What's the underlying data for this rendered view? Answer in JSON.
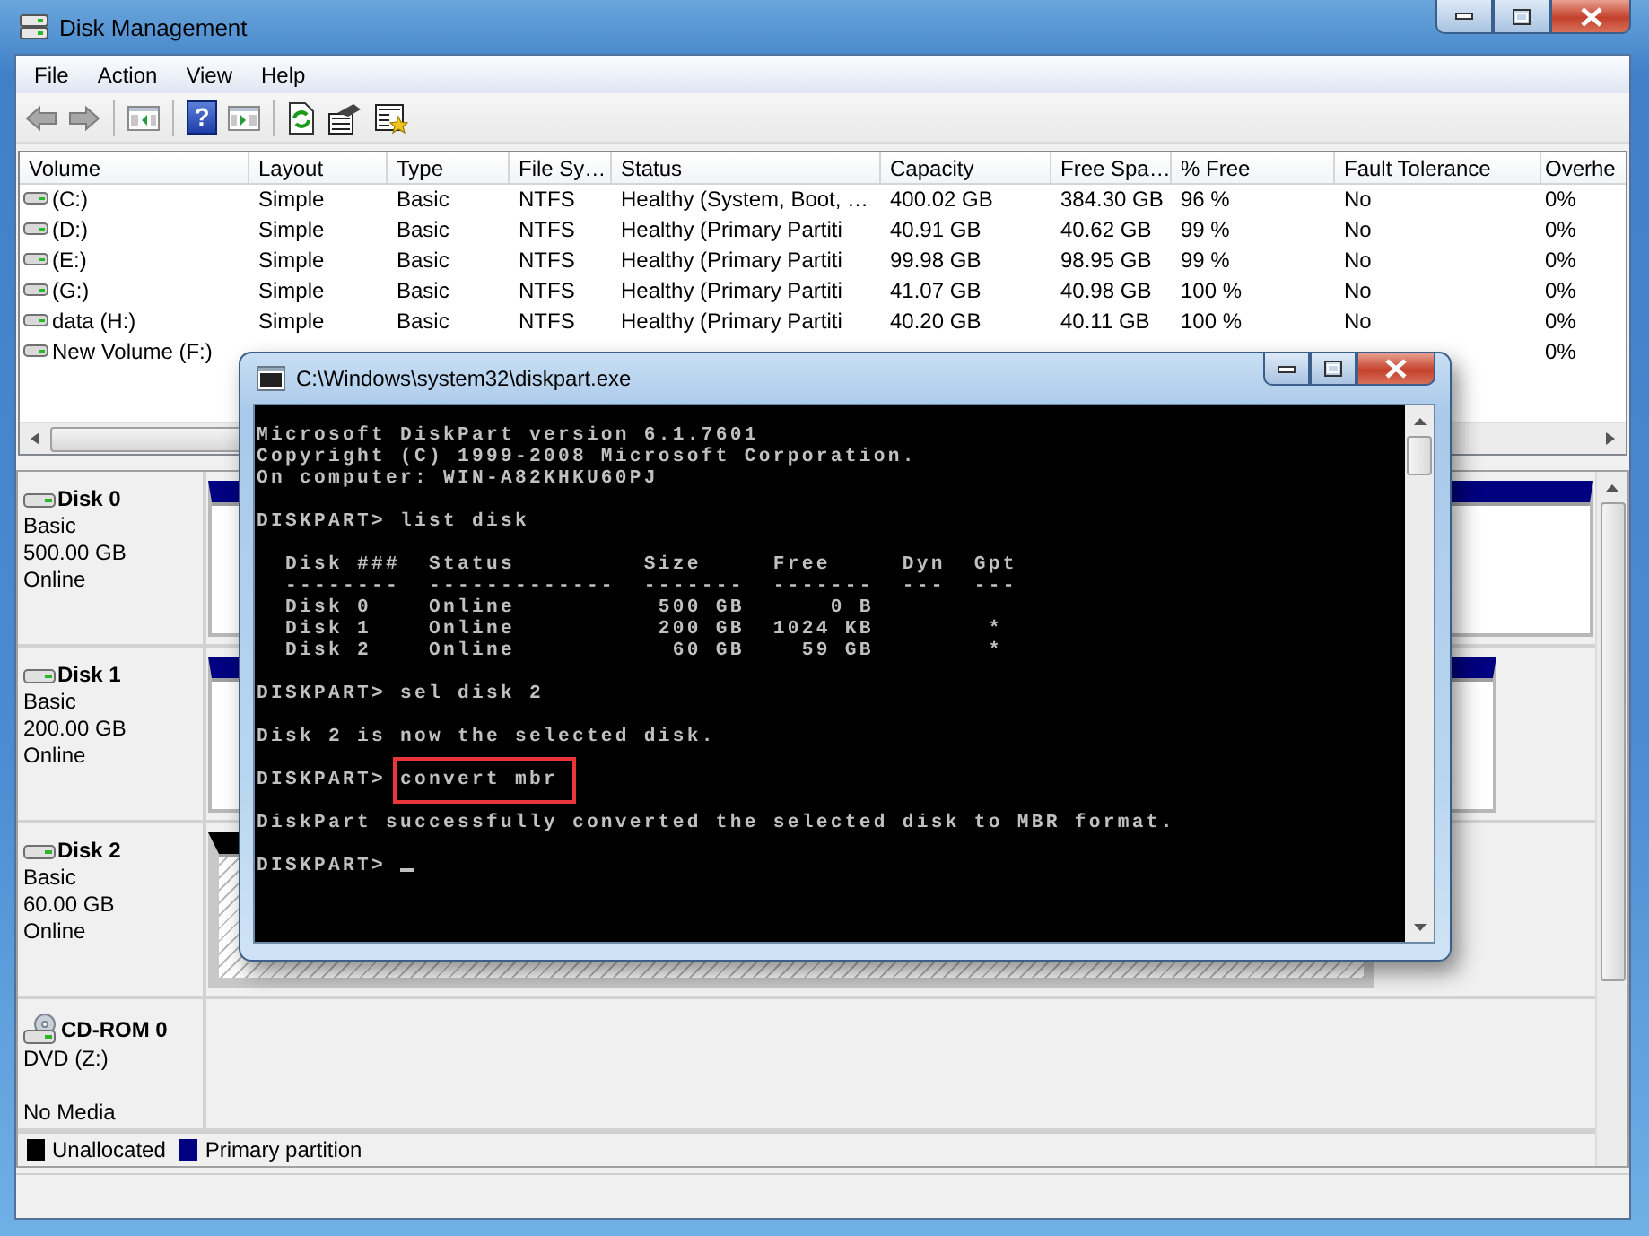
{
  "window": {
    "title": "Disk Management"
  },
  "menu": [
    "File",
    "Action",
    "View",
    "Help"
  ],
  "toolbar": [
    {
      "kind": "back"
    },
    {
      "kind": "forward"
    },
    {
      "kind": "separator"
    },
    {
      "kind": "tree"
    },
    {
      "kind": "separator"
    },
    {
      "kind": "help",
      "label": "?"
    },
    {
      "kind": "pane"
    },
    {
      "kind": "separator"
    },
    {
      "kind": "refresh"
    },
    {
      "kind": "properties"
    },
    {
      "kind": "snapin"
    }
  ],
  "volumes": {
    "columns": [
      "Volume",
      "Layout",
      "Type",
      "File Sy…",
      "Status",
      "Capacity",
      "Free Spa…",
      "% Free",
      "Fault Tolerance",
      "Overhe"
    ],
    "rows": [
      {
        "cells": [
          "(C:)",
          "Simple",
          "Basic",
          "NTFS",
          "Healthy (System, Boot, …",
          "400.02 GB",
          "384.30 GB",
          "96 %",
          "No",
          "0%"
        ]
      },
      {
        "cells": [
          "(D:)",
          "Simple",
          "Basic",
          "NTFS",
          "Healthy (Primary Partiti",
          "40.91 GB",
          "40.62 GB",
          "99 %",
          "No",
          "0%"
        ]
      },
      {
        "cells": [
          "(E:)",
          "Simple",
          "Basic",
          "NTFS",
          "Healthy (Primary Partiti",
          "99.98 GB",
          "98.95 GB",
          "99 %",
          "No",
          "0%"
        ]
      },
      {
        "cells": [
          "(G:)",
          "Simple",
          "Basic",
          "NTFS",
          "Healthy (Primary Partiti",
          "41.07 GB",
          "40.98 GB",
          "100 %",
          "No",
          "0%"
        ]
      },
      {
        "cells": [
          "data (H:)",
          "Simple",
          "Basic",
          "NTFS",
          "Healthy (Primary Partiti",
          "40.20 GB",
          "40.11 GB",
          "100 %",
          "No",
          "0%"
        ]
      },
      {
        "cells": [
          "New Volume (F:)",
          null,
          null,
          null,
          null,
          null,
          null,
          null,
          null,
          "0%"
        ]
      }
    ]
  },
  "disks": [
    {
      "kind": "disk",
      "name": "Disk 0",
      "type": "Basic",
      "size": "500.00 GB",
      "status": "Online",
      "partitions": [
        {
          "kind": "primary"
        }
      ]
    },
    {
      "kind": "disk",
      "name": "Disk 1",
      "type": "Basic",
      "size": "200.00 GB",
      "status": "Online",
      "partitions": [
        {
          "kind": "primary"
        }
      ]
    },
    {
      "kind": "disk",
      "name": "Disk 2",
      "type": "Basic",
      "size": "60.00 GB",
      "status": "Online",
      "partitions": [
        {
          "kind": "unallocated"
        }
      ]
    },
    {
      "kind": "cdrom",
      "name": "CD-ROM 0",
      "type": "DVD (Z:)",
      "status": "No Media"
    }
  ],
  "legend": [
    {
      "label": "Unallocated",
      "color": "#000000"
    },
    {
      "label": "Primary partition",
      "color": "#000080"
    }
  ],
  "console": {
    "title": "C:\\Windows\\system32\\diskpart.exe",
    "blocks": [
      {
        "lines": [
          {
            "kind": "output",
            "text": "Microsoft DiskPart version 6.1.7601"
          },
          {
            "kind": "output",
            "text": "Copyright (C) 1999-2008 Microsoft Corporation."
          },
          {
            "kind": "output",
            "text": "On computer: WIN-A82KHKU60PJ"
          }
        ]
      },
      {
        "lines": [
          {
            "kind": "command",
            "prompt": "DISKPART>",
            "command": "list disk",
            "highlighted": false
          }
        ]
      },
      {
        "lines": [
          {
            "kind": "output",
            "text": "  Disk ###  Status         Size     Free     Dyn  Gpt"
          },
          {
            "kind": "output",
            "text": "  --------  -------------  -------  -------  ---  ---"
          },
          {
            "kind": "output",
            "text": "  Disk 0    Online          500 GB      0 B"
          },
          {
            "kind": "output",
            "text": "  Disk 1    Online          200 GB  1024 KB        *"
          },
          {
            "kind": "output",
            "text": "  Disk 2    Online           60 GB    59 GB        *"
          }
        ]
      },
      {
        "lines": [
          {
            "kind": "command",
            "prompt": "DISKPART>",
            "command": "sel disk 2",
            "highlighted": false
          }
        ]
      },
      {
        "lines": [
          {
            "kind": "output",
            "text": "Disk 2 is now the selected disk."
          }
        ]
      },
      {
        "lines": [
          {
            "kind": "command",
            "prompt": "DISKPART>",
            "command": "convert mbr",
            "highlighted": true
          }
        ]
      },
      {
        "lines": [
          {
            "kind": "output",
            "text": "DiskPart successfully converted the selected disk to MBR format."
          }
        ]
      },
      {
        "lines": [
          {
            "kind": "command",
            "prompt": "DISKPART>",
            "cursor": true
          }
        ]
      }
    ]
  }
}
